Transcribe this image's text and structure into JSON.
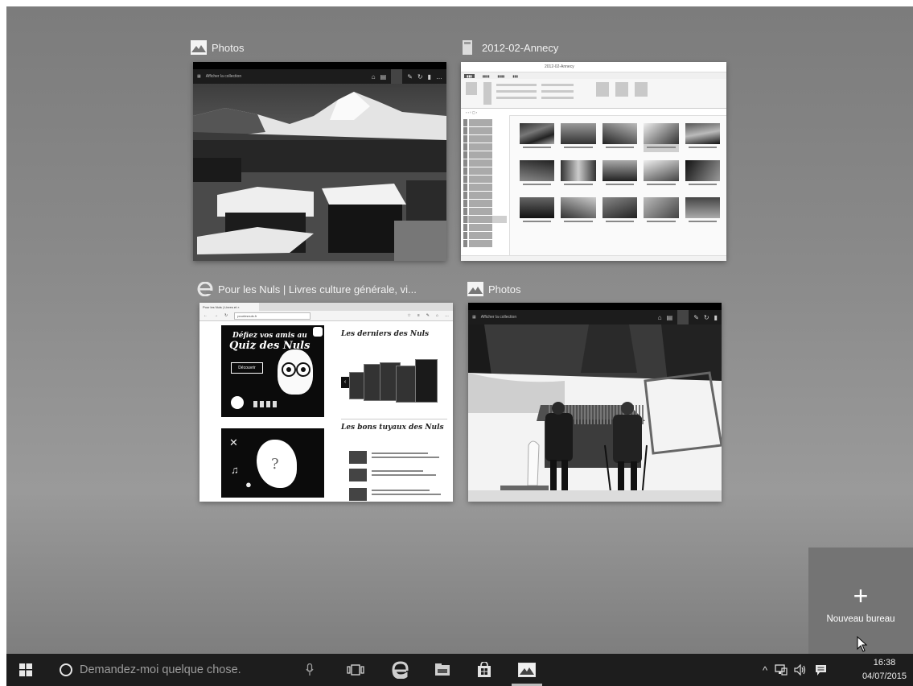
{
  "task_view": {
    "windows": [
      {
        "id": "photos-1",
        "app": "Photos",
        "title": "Photos",
        "thumb_title": "Photos",
        "toolbar_label": "Afficher la collection"
      },
      {
        "id": "explorer",
        "app": "File Explorer",
        "title": "2012-02-Annecy",
        "thumb_title": "2012-02-Annecy"
      },
      {
        "id": "edge",
        "app": "Microsoft Edge",
        "title": "Pour les Nuls | Livres culture générale, vi...",
        "tab_label": "Pour les Nuls | Livres et ×",
        "address": "pourlesnuls.fr",
        "quiz_line1": "Défiez vos amis au",
        "quiz_line2": "Quiz des Nuls",
        "quiz_button": "Découvrir",
        "section1": "Les derniers des Nuls",
        "section2": "Les bons tuyaux des Nuls"
      },
      {
        "id": "photos-2",
        "app": "Photos",
        "title": "Photos",
        "thumb_title": "Photos",
        "toolbar_label": "Afficher la collection"
      }
    ],
    "new_desktop": {
      "plus": "+",
      "label": "Nouveau bureau"
    }
  },
  "taskbar": {
    "search_placeholder": "Demandez-moi quelque chose.",
    "pinned": [
      "start-icon",
      "microphone-icon",
      "task-view-icon",
      "edge-icon",
      "file-explorer-icon",
      "store-icon",
      "photos-icon"
    ],
    "tray": [
      "chevron-up-icon",
      "network-icon",
      "volume-icon",
      "action-center-icon"
    ],
    "time": "16:38",
    "date": "04/07/2015"
  }
}
